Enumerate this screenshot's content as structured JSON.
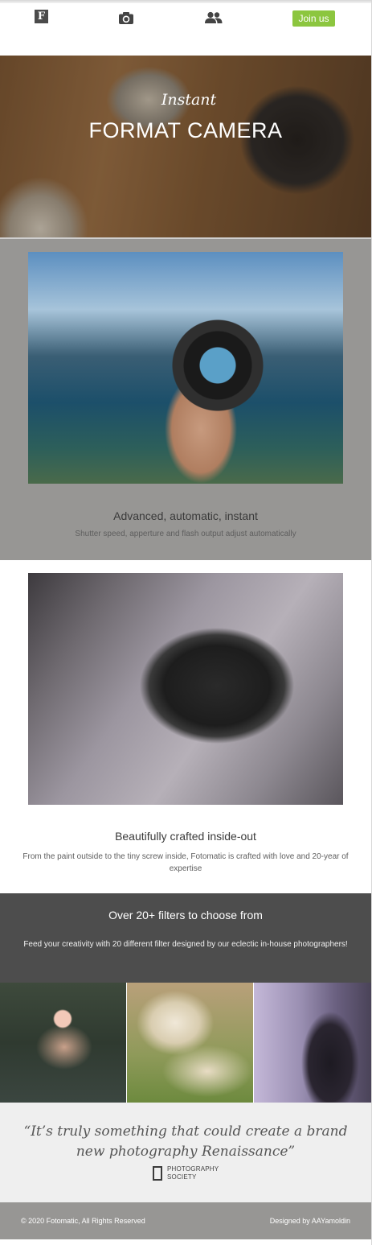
{
  "nav": {
    "items": [
      {
        "name": "logo-icon",
        "glyph": "F"
      },
      {
        "name": "camera-icon"
      },
      {
        "name": "group-icon"
      }
    ],
    "join_label": "Join us",
    "accent_color": "#8cc63f"
  },
  "hero": {
    "kicker": "Instant",
    "title": "FORMAT CAMERA"
  },
  "features": [
    {
      "title": "Advanced, automatic, instant",
      "subtitle": "Shutter speed, apperture and flash output adjust automatically"
    },
    {
      "title": "Beautifully crafted inside-out",
      "subtitle": "From the paint outside to the tiny screw inside, Fotomatic is crafted with love and 20-year of expertise"
    }
  ],
  "filters": {
    "title": "Over 20+ filters to choose from",
    "subtitle": "Feed your creativity with 20 different filter designed by our eclectic in-house photographers!"
  },
  "quote": {
    "text": "“It’s truly something that could create a brand new photography Renaissance”",
    "source_line1": "PHOTOGRAPHY",
    "source_line2": "SOCIETY"
  },
  "footer": {
    "copyright": "© 2020 Fotomatic, All Rights Reserved",
    "credit": "Designed by AAYamoldin"
  }
}
